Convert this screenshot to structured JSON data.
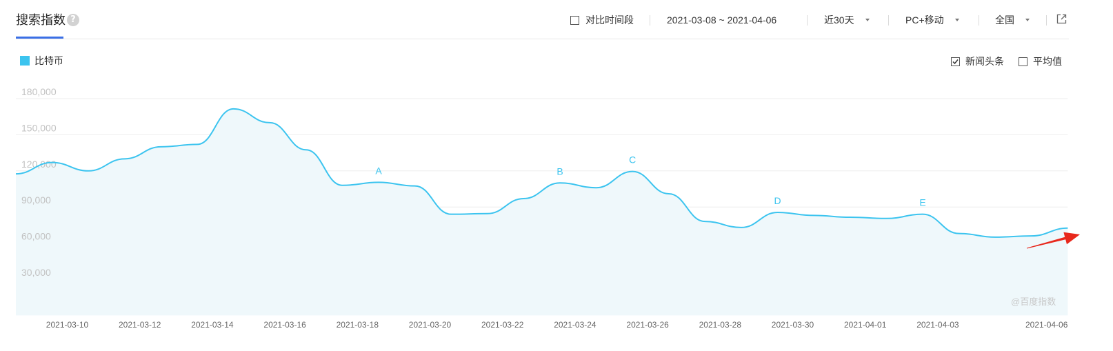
{
  "header": {
    "tab_title": "搜索指数",
    "compare_period": {
      "label": "对比时间段",
      "checked": false
    },
    "date_range": "2021-03-08 ~ 2021-04-06",
    "period_select": "近30天",
    "device_select": "PC+移动",
    "region_select": "全国"
  },
  "toggles": {
    "news_headlines": {
      "label": "新闻头条",
      "checked": true
    },
    "average": {
      "label": "平均值",
      "checked": false
    }
  },
  "watermark": "@百度指数",
  "icons": {
    "help": "question-circle-icon",
    "dropdown": "chevron-down-icon",
    "external_link": "external-link-icon",
    "check": "check-icon"
  },
  "colors": {
    "accent": "#3a6fe6",
    "series": "#3cc4ef",
    "area_fill": "#eff8fb",
    "arrow": "#e8281c"
  },
  "chart_data": {
    "type": "line",
    "smooth": true,
    "filled_area": true,
    "grid": true,
    "legend_position": "top-left",
    "x": [
      "2021-03-08",
      "2021-03-09",
      "2021-03-10",
      "2021-03-11",
      "2021-03-12",
      "2021-03-13",
      "2021-03-14",
      "2021-03-15",
      "2021-03-16",
      "2021-03-17",
      "2021-03-18",
      "2021-03-19",
      "2021-03-20",
      "2021-03-21",
      "2021-03-22",
      "2021-03-23",
      "2021-03-24",
      "2021-03-25",
      "2021-03-26",
      "2021-03-27",
      "2021-03-28",
      "2021-03-29",
      "2021-03-30",
      "2021-03-31",
      "2021-04-01",
      "2021-04-02",
      "2021-04-03",
      "2021-04-04",
      "2021-04-05",
      "2021-04-06"
    ],
    "series": [
      {
        "name": "比特币",
        "values": [
          117500,
          127000,
          120000,
          130000,
          140000,
          142000,
          171500,
          160000,
          137500,
          108000,
          110500,
          107500,
          84000,
          84500,
          97000,
          110000,
          106000,
          119500,
          101000,
          78000,
          73000,
          85500,
          83000,
          81500,
          80500,
          84000,
          68000,
          65000,
          66000,
          72500
        ]
      }
    ],
    "ylim": [
      0,
      180000
    ],
    "y_ticks": [
      30000,
      60000,
      90000,
      120000,
      150000,
      180000
    ],
    "y_tick_labels": [
      "30,000",
      "60,000",
      "90,000",
      "120,000",
      "150,000",
      "180,000"
    ],
    "x_tick_labels": [
      "2021-03-10",
      "2021-03-12",
      "2021-03-14",
      "2021-03-16",
      "2021-03-18",
      "2021-03-20",
      "2021-03-22",
      "2021-03-24",
      "2021-03-26",
      "2021-03-28",
      "2021-03-30",
      "2021-04-01",
      "2021-04-03",
      "2021-04-06"
    ],
    "annotations": [
      {
        "label": "A",
        "x": "2021-03-18"
      },
      {
        "label": "B",
        "x": "2021-03-23"
      },
      {
        "label": "C",
        "x": "2021-03-25"
      },
      {
        "label": "D",
        "x": "2021-03-29"
      },
      {
        "label": "E",
        "x": "2021-04-02"
      }
    ]
  }
}
